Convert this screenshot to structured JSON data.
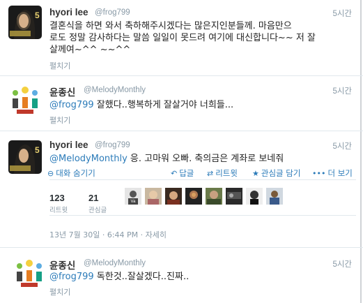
{
  "tweets": [
    {
      "name": "hyori lee",
      "handle": "@frog799",
      "time": "5시간",
      "text_line1": "결혼식을 하면 와서 축하해주시겠다는 많은지인분들께. 마음만으",
      "text_line2": "로도 정말 감사하다는 말씀 일일이 못드려 여기에 대신합니다~~ 저 잘",
      "text_line3": "살께여~^^ ~~^^",
      "expand": "펼치기"
    },
    {
      "name": "윤종신",
      "handle": "@MelodyMonthly",
      "time": "5시간",
      "mention": "@frog799",
      "text": " 잘했다..행복하게 잘살거야 너희들...",
      "expand": "펼치기"
    },
    {
      "name": "hyori lee",
      "handle": "@frog799",
      "time": "5시간",
      "mention": "@MelodyMonthly",
      "text": " 응. 고마워 오빠. 축의금은 계좌로 보네줘",
      "hide_conversation": "대화 숨기기",
      "actions": {
        "reply": "답글",
        "retweet": "리트윗",
        "favorite": "관심글 담기",
        "more": "더 보기"
      },
      "stats": {
        "retweets_count": "123",
        "retweets_label": "리트윗",
        "favorites_count": "21",
        "favorites_label": "관심글"
      },
      "date": "13년 7월 30일 · 6:44 PM · 자세히"
    },
    {
      "name": "윤종신",
      "handle": "@MelodyMonthly",
      "time": "5시간",
      "mention": "@frog799",
      "text": " 독한것..잘살겠다..진짜..",
      "expand": "펼치기"
    }
  ],
  "icons": {
    "hide": "arrow-down-circle-icon",
    "reply": "reply-icon",
    "retweet": "retweet-icon",
    "favorite": "star-icon",
    "more": "more-dots-icon"
  },
  "colors": {
    "link": "#2b7bb9",
    "meta": "#8899a6",
    "separator": "#e1e8ed"
  }
}
